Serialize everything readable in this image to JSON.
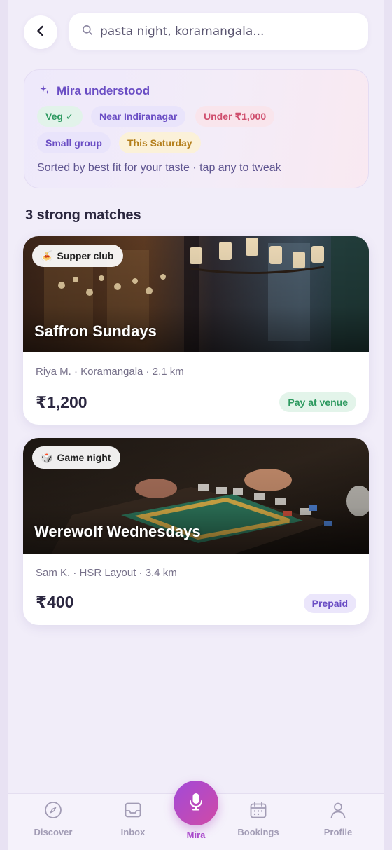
{
  "header": {
    "search_value": "pasta night, koramangala..."
  },
  "mira": {
    "title": "Mira understood",
    "chips": {
      "veg": "Veg ✓",
      "near": "Near Indiranagar",
      "budget": "Under ₹1,000",
      "group": "Small group",
      "when": "This Saturday"
    },
    "subtitle": "Sorted by best fit for your taste · tap any to tweak"
  },
  "results": {
    "title": "3 strong matches",
    "events": [
      {
        "category_icon": "🍝",
        "category": "Supper club",
        "title": "Saffron Sundays",
        "meta": "Riya M. · Koramangala · 2.1 km",
        "price": "₹1,200",
        "payment": "Pay at venue"
      },
      {
        "category_icon": "🎲",
        "category": "Game night",
        "title": "Werewolf Wednesdays",
        "meta": "Sam K. · HSR Layout · 3.4 km",
        "price": "₹400",
        "payment": "Prepaid"
      }
    ]
  },
  "nav": {
    "discover": "Discover",
    "inbox": "Inbox",
    "mira": "Mira",
    "bookings": "Bookings",
    "profile": "Profile"
  },
  "colors": {
    "accent": "#6a4dc4",
    "mira_gradient_start": "#a24ad8",
    "mira_gradient_end": "#d04aa6",
    "success": "#2e9a60"
  }
}
